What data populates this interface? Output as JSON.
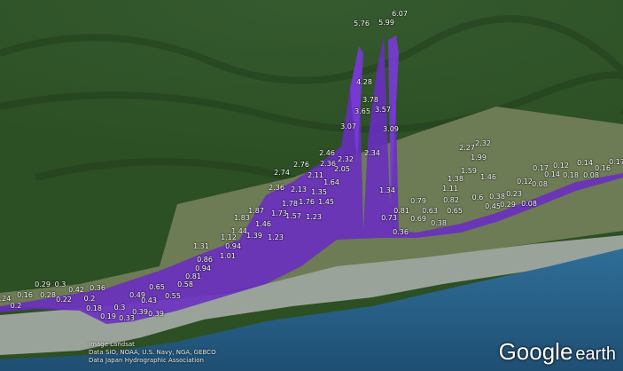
{
  "map": {
    "attribution": [
      "Image Landsat",
      "Data SIO, NOAA, U.S. Navy, NGA, GEBCO",
      "Data Japan Hydrographic Association"
    ],
    "logo": {
      "brand": "Google",
      "product": "earth"
    },
    "colors": {
      "bars": "#6a2cc4",
      "forest": "#2c4f24",
      "sea": "#2a5f86",
      "urban": "#9aa39a"
    }
  },
  "labels": [
    "6.07",
    "5.76",
    "5.99",
    "4.28",
    "3.78",
    "3.65",
    "3.57",
    "3.07",
    "3.09",
    "2.46",
    "2.36",
    "2.32",
    "2.76",
    "2.11",
    "2.05",
    "2.34",
    "2.74",
    "1.64",
    "2.36",
    "2.13",
    "1.35",
    "1.78",
    "1.76",
    "1.45",
    "1.87",
    "1.73",
    "1.57",
    "1.23",
    "1.34",
    "1.83",
    "1.46",
    "1.44",
    "1.12",
    "1.39",
    "1.23",
    "0.94",
    "1.31",
    "1.01",
    "0.86",
    "0.94",
    "0.81",
    "0.58",
    "0.65",
    "0.55",
    "0.49",
    "0.43",
    "0.39",
    "0.3",
    "0.39",
    "0.19",
    "0.33",
    "0.42",
    "0.36",
    "0.2",
    "0.18",
    "0.29",
    "0.3",
    "0.28",
    "0.22",
    "0.16",
    ".24",
    "0.2",
    "0.79",
    "0.81",
    "0.73",
    "0.69",
    "0.63",
    "0.38",
    "0.36",
    "0.82",
    "0.65",
    "1.11",
    "1.38",
    "1.59",
    "1.46",
    "2.27",
    "2.32",
    "1.99",
    "0.6",
    "0.38",
    "0.23",
    "0.45",
    "0.29",
    "0.08",
    "0.12",
    "0.08",
    "0.17",
    "0.14",
    "0.12",
    "0.14",
    "0.18",
    "0.08",
    "0.16",
    "0.17"
  ]
}
